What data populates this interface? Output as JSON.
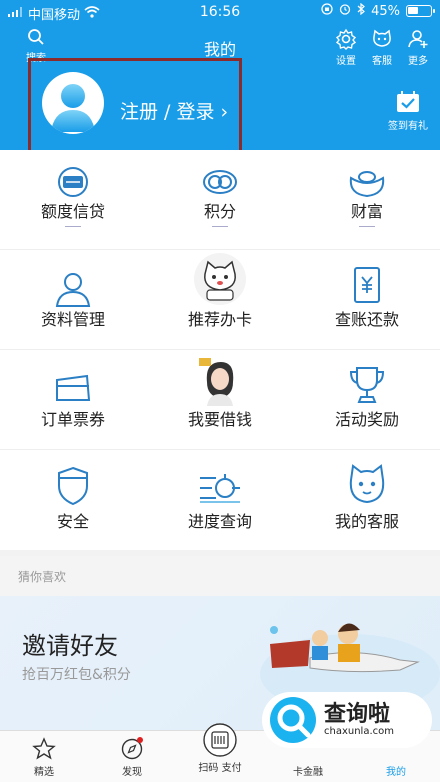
{
  "status_bar": {
    "carrier": "中国移动",
    "time": "16:56",
    "battery": "45%",
    "battery_level": 0.45
  },
  "header": {
    "title": "我的",
    "search_label": "搜索",
    "settings_label": "设置",
    "service_label": "客服",
    "more_label": "更多",
    "login_text": "注册 / 登录 ›",
    "checkin_label": "签到有礼"
  },
  "menu": {
    "rows": [
      [
        {
          "label": "额度信贷",
          "icon": "credit-badge-icon"
        },
        {
          "label": "积分",
          "icon": "points-icon"
        },
        {
          "label": "财富",
          "icon": "wealth-ingot-icon"
        }
      ],
      [
        {
          "label": "资料管理",
          "icon": "profile-icon"
        },
        {
          "label": "推荐办卡",
          "icon": "lucky-cat-icon"
        },
        {
          "label": "查账还款",
          "icon": "bill-yen-icon"
        }
      ],
      [
        {
          "label": "订单票券",
          "icon": "ticket-icon"
        },
        {
          "label": "我要借钱",
          "icon": "woman-avatar-icon"
        },
        {
          "label": "活动奖励",
          "icon": "trophy-icon"
        }
      ],
      [
        {
          "label": "安全",
          "icon": "shield-icon"
        },
        {
          "label": "进度查询",
          "icon": "progress-icon"
        },
        {
          "label": "我的客服",
          "icon": "service-cat-icon"
        }
      ]
    ]
  },
  "guess_section": {
    "label": "猜你喜欢"
  },
  "banner": {
    "title": "邀请好友",
    "subtitle": "抢百万红包&积分"
  },
  "tabbar": {
    "items": [
      {
        "label": "精选"
      },
      {
        "label": "发现"
      },
      {
        "label": "扫码 支付"
      },
      {
        "label": "卡金融"
      },
      {
        "label": "我的"
      }
    ]
  },
  "watermark": {
    "main": "查询啦",
    "url": "chaxunla.com"
  },
  "colors": {
    "header_bg": "#1a9de8",
    "icon_blue": "#2b7fc4",
    "highlight_box": "#8b2b2b"
  }
}
